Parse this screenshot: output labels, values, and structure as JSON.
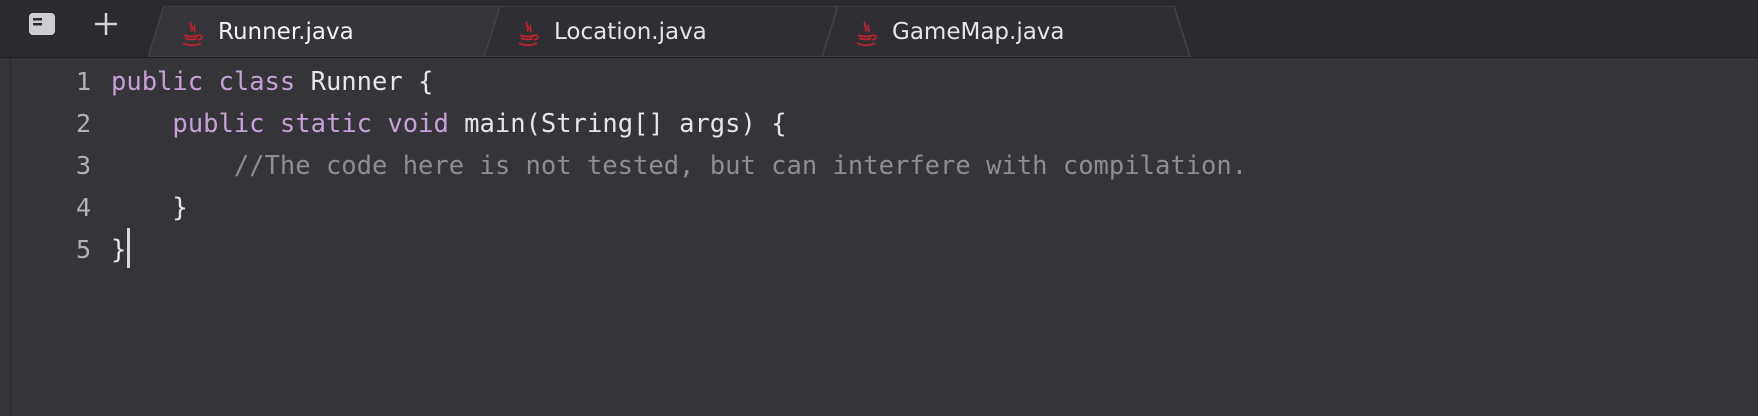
{
  "colors": {
    "background": "#353438",
    "tabbar": "#2b2a2e",
    "keyword": "#c79fd9",
    "comment": "#8f8d93",
    "text": "#e7e5ea",
    "line_number": "#b3b1b8",
    "java_icon": "#c8202f"
  },
  "toolbar": {
    "sidebar_icon": "sidebar-panel-icon",
    "add_icon": "plus-icon"
  },
  "tabs": [
    {
      "label": "Runner.java",
      "icon": "java-cup-icon",
      "active": true
    },
    {
      "label": "Location.java",
      "icon": "java-cup-icon",
      "active": false
    },
    {
      "label": "GameMap.java",
      "icon": "java-cup-icon",
      "active": false
    }
  ],
  "editor": {
    "lines": [
      {
        "number": "1",
        "tokens": [
          {
            "kw": "public"
          },
          {
            "t": " "
          },
          {
            "kw": "class"
          },
          {
            "t": " Runner {"
          }
        ]
      },
      {
        "number": "2",
        "tokens": [
          {
            "t": "    "
          },
          {
            "kw": "public"
          },
          {
            "t": " "
          },
          {
            "kw": "static"
          },
          {
            "t": " "
          },
          {
            "kw": "void"
          },
          {
            "t": " main(String[] args) {"
          }
        ]
      },
      {
        "number": "3",
        "tokens": [
          {
            "t": "        "
          },
          {
            "cm": "//The code here is not tested, but can interfere with compilation."
          }
        ]
      },
      {
        "number": "4",
        "tokens": [
          {
            "t": "    }"
          }
        ]
      },
      {
        "number": "5",
        "tokens": [
          {
            "t": "}"
          }
        ],
        "cursor": true
      }
    ]
  }
}
